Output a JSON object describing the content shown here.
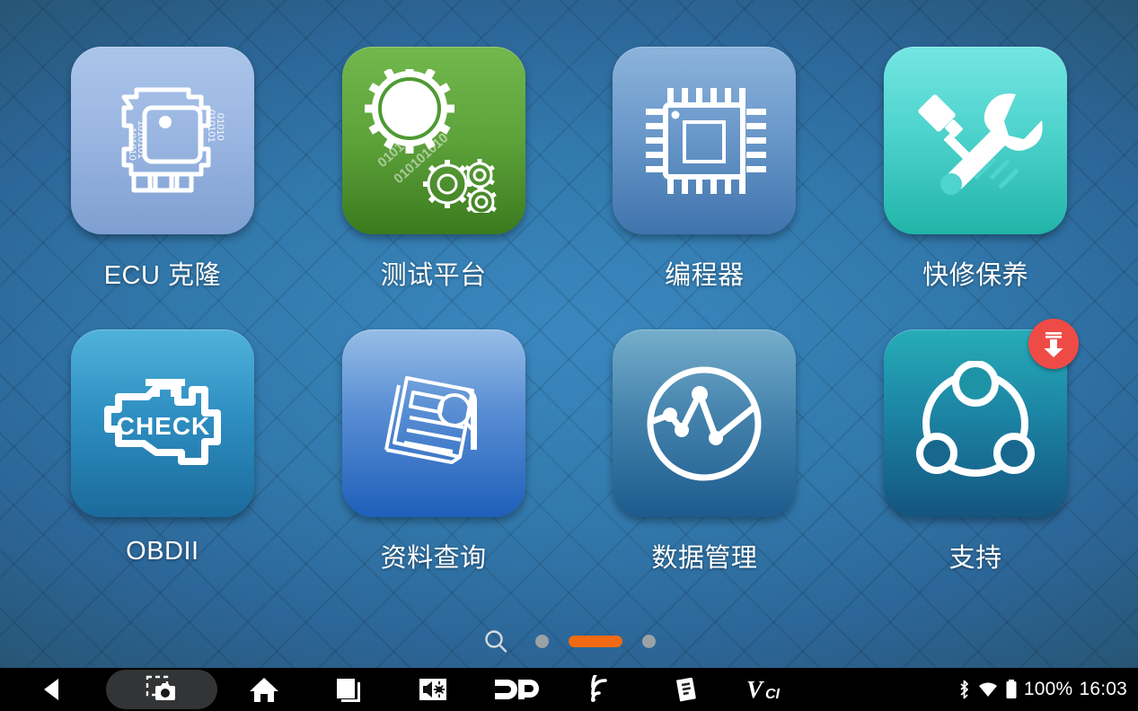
{
  "background": {
    "accent_orange": "#f26a13",
    "base_blue": "#3279ac",
    "edge_blue": "#24445f"
  },
  "home": {
    "apps": [
      {
        "id": "ecu-clone",
        "label": "ECU 克隆",
        "icon": "ecu-module-icon",
        "tile_from": "#a9c3e8",
        "tile_to": "#7f9fd2",
        "badge": null
      },
      {
        "id": "test-platform",
        "label": "测试平台",
        "icon": "can-gear-icon",
        "tile_from": "#6fb64a",
        "tile_to": "#3c7a1f",
        "badge": null
      },
      {
        "id": "programmer",
        "label": "编程器",
        "icon": "chip-icon",
        "tile_from": "#86aed7",
        "tile_to": "#3f74ad",
        "badge": null
      },
      {
        "id": "quick-repair",
        "label": "快修保养",
        "icon": "wrench-screwdriver-icon",
        "tile_from": "#6fe3e0",
        "tile_to": "#24b8ab",
        "badge": null
      },
      {
        "id": "obdii",
        "label": "OBDII",
        "icon": "check-engine-icon",
        "tile_from": "#4aaed8",
        "tile_to": "#1d6e9e",
        "badge": null
      },
      {
        "id": "data-query",
        "label": "资料查询",
        "icon": "documents-search-icon",
        "tile_from": "#8fb8e4",
        "tile_to": "#1f5fba",
        "badge": null
      },
      {
        "id": "data-manage",
        "label": "数据管理",
        "icon": "chart-circle-icon",
        "tile_from": "#6ea8c4",
        "tile_to": "#1d5b8e",
        "badge": null
      },
      {
        "id": "support",
        "label": "支持",
        "icon": "support-network-icon",
        "tile_from": "#24a9b5",
        "tile_to": "#14557f",
        "badge": "download-badge"
      }
    ]
  },
  "pager": {
    "search_icon": "search-icon",
    "pages": [
      {
        "index": 1,
        "active": false
      },
      {
        "index": 2,
        "active": true
      },
      {
        "index": 3,
        "active": false
      }
    ]
  },
  "navbar": {
    "buttons": [
      {
        "id": "back",
        "icon": "back-triangle-icon",
        "highlighted": false
      },
      {
        "id": "screenshot",
        "icon": "camera-icon",
        "highlighted": true
      },
      {
        "id": "home",
        "icon": "home-icon",
        "highlighted": false
      },
      {
        "id": "recents",
        "icon": "recents-square-icon",
        "highlighted": false
      },
      {
        "id": "volume",
        "icon": "volume-brightness-icon",
        "highlighted": false
      },
      {
        "id": "dp-logo",
        "icon": "dp-logo-icon",
        "highlighted": false
      },
      {
        "id": "wireless",
        "icon": "wireless-signal-icon",
        "highlighted": false
      },
      {
        "id": "manual",
        "icon": "manual-book-icon",
        "highlighted": false
      },
      {
        "id": "vci",
        "icon": "vci-logo-icon",
        "highlighted": false
      }
    ],
    "status": {
      "bluetooth_icon": "bluetooth-icon",
      "wifi_icon": "wifi-icon",
      "battery_icon": "battery-full-icon",
      "battery_percent": "100%",
      "clock": "16:03"
    }
  }
}
